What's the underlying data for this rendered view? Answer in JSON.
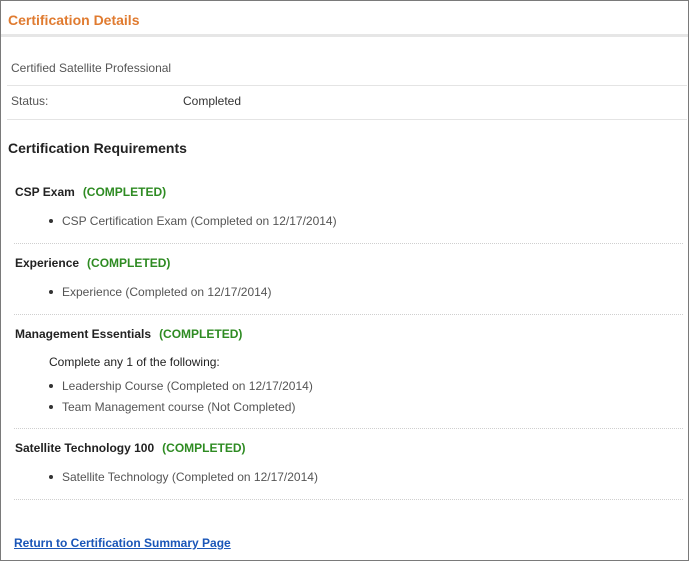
{
  "header": {
    "title": "Certification Details"
  },
  "details": {
    "certification_name": "Certified Satellite Professional",
    "status_label": "Status:",
    "status_value": "Completed"
  },
  "requirements": {
    "heading": "Certification Requirements",
    "sections": [
      {
        "title": "CSP Exam",
        "status": "(COMPLETED)",
        "items": [
          "CSP Certification Exam (Completed on 12/17/2014)"
        ]
      },
      {
        "title": "Experience",
        "status": "(COMPLETED)",
        "items": [
          "Experience (Completed on 12/17/2014)"
        ]
      },
      {
        "title": "Management Essentials",
        "status": "(COMPLETED)",
        "note": "Complete any 1 of the following:",
        "items": [
          "Leadership Course (Completed on 12/17/2014)",
          "Team Management course (Not Completed)"
        ]
      },
      {
        "title": "Satellite Technology 100",
        "status": "(COMPLETED)",
        "items": [
          "Satellite Technology (Completed on 12/17/2014)"
        ]
      }
    ]
  },
  "footer": {
    "return_link": "Return to Certification Summary Page"
  },
  "colors": {
    "header_accent": "#e07b30",
    "completed_status": "#2e8b22",
    "link": "#1a56b8"
  }
}
